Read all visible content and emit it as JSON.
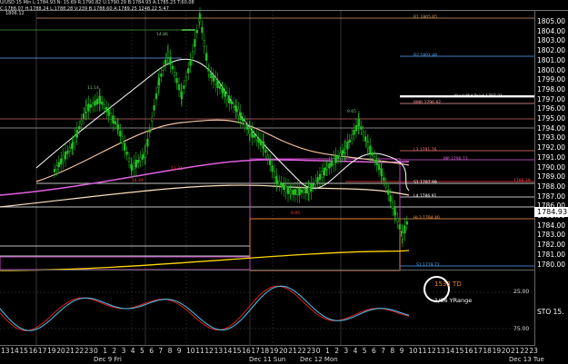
{
  "header": {
    "line1": "U/USD 15 Min L:1784.93 N: 15.69 R:1790.82 U:1790.29 B:1784.93 A:1785.25 T:60.08",
    "line2": "C:1788.07 H:1788.24 L:1788.28 V:239 B:1788.60 A:1789.25 1248.22 5:47",
    "panel_title": "1806.12"
  },
  "price_axis": {
    "labels": [
      "1805.00",
      "1804.00",
      "1803.00",
      "1802.00",
      "1801.00",
      "1800.00",
      "1799.00",
      "1798.00",
      "1797.00",
      "1796.00",
      "1795.00",
      "1794.00",
      "1793.00",
      "1792.00",
      "1791.00",
      "1790.00",
      "1789.00",
      "1788.00",
      "1787.00",
      "1786.00",
      "1785.00",
      "1784.00",
      "1783.00",
      "1782.00",
      "1781.00",
      "1780.00"
    ],
    "last_price": "1784.93",
    "last_price_color": "#ffffff"
  },
  "oscillator": {
    "name": "STO",
    "value": "15.",
    "levels": [
      "25.00",
      "75.00"
    ]
  },
  "callout": {
    "value": "1533 TD",
    "caption": "1/66 YRange"
  },
  "annotations": [
    {
      "text": "R1 1805.65",
      "color": "#e0a070"
    },
    {
      "text": "R2 1801.48",
      "color": "#4fa8ff"
    },
    {
      "text": "Yearl Mid Point 1797.21",
      "color": "#ffffff"
    },
    {
      "text": "RMR 1796.62",
      "color": "#ff9c9c"
    },
    {
      "text": "L3 1791.76",
      "color": "#ff7a7a"
    },
    {
      "text": "MP 1790.73",
      "color": "#e060e0"
    },
    {
      "text": "S1 1787.99",
      "color": "#ffffff"
    },
    {
      "text": "L4 1786.91",
      "color": "#ffffff"
    },
    {
      "text": "1788.39",
      "color": "#ff4040"
    },
    {
      "text": "HL3 1784.40",
      "color": "#ff9c4c"
    },
    {
      "text": "S1 1779.72",
      "color": "#4fa8ff"
    },
    {
      "text": "14.86",
      "color": "#7fbf7f"
    },
    {
      "text": "11.14",
      "color": "#7fbf7f"
    },
    {
      "text": "9.65",
      "color": "#7fbf7f"
    },
    {
      "text": "13.31",
      "color": "#ff4040"
    },
    {
      "text": "9.95",
      "color": "#ff4040"
    },
    {
      "text": "14.44",
      "color": "#ff4040"
    }
  ],
  "time_axis": {
    "hours": [
      "13",
      "14",
      "15",
      "16",
      "17",
      "19",
      "20",
      "21",
      "22",
      "23",
      "0",
      "1",
      "2",
      "3",
      "4",
      "5",
      "6",
      "7",
      "8",
      "9",
      "10",
      "11",
      "12",
      "13",
      "14",
      "15",
      "16",
      "17",
      "18",
      "19",
      "20",
      "21",
      "22",
      "23",
      "0",
      "1",
      "2",
      "3",
      "4",
      "5",
      "6",
      "7",
      "8",
      "9",
      "10",
      "11",
      "12",
      "13",
      "14",
      "15",
      "16",
      "17",
      "18",
      "19",
      "20",
      "21",
      "22",
      "23"
    ],
    "dates": [
      "Dec 9 Fri",
      "Dec 11 Sun",
      "Dec 12 Mon",
      "Dec 13 Tue"
    ]
  },
  "colors": {
    "background": "#000000",
    "candle": "#22c022",
    "stoch_k": "#4fc8f0",
    "stoch_d": "#e02020",
    "ma_white": "#ffffff",
    "ma_pink": "#e060e0",
    "ma_orange": "#f0a020",
    "ma_yellow": "#ffd700"
  }
}
